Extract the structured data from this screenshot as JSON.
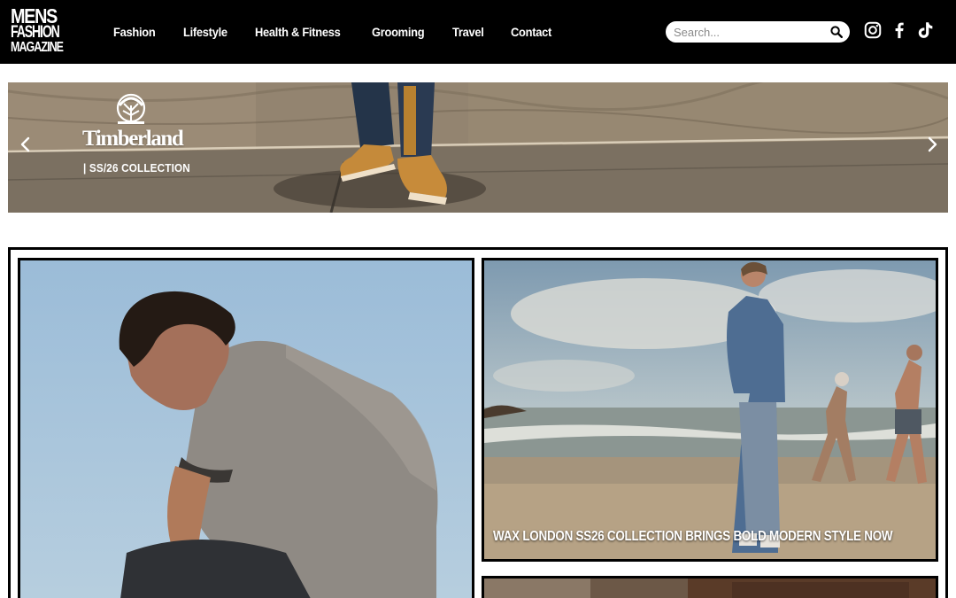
{
  "logo": {
    "line1": "MENS",
    "line2": "FASHION",
    "line3": "MAGAZINE"
  },
  "nav": {
    "items": [
      {
        "label": "Fashion"
      },
      {
        "label": "Lifestyle"
      },
      {
        "label": "Health & Fitness"
      },
      {
        "label": "Grooming"
      },
      {
        "label": "Travel"
      },
      {
        "label": "Contact"
      }
    ]
  },
  "search": {
    "placeholder": "Search...",
    "value": "",
    "icon": "search-icon"
  },
  "social": {
    "icons": [
      "instagram-icon",
      "facebook-icon",
      "tiktok-icon"
    ]
  },
  "banner": {
    "brand": "Timberland",
    "subtitle": "| SS/26 COLLECTION",
    "prev_icon": "chevron-left-icon",
    "next_icon": "chevron-right-icon"
  },
  "articles": [
    {
      "title": ""
    },
    {
      "title": "WAX LONDON SS26 COLLECTION BRINGS BOLD MODERN STYLE NOW"
    },
    {
      "title": ""
    }
  ],
  "colors": {
    "header_bg": "#000000",
    "text_light": "#ffffff",
    "border": "#000000"
  }
}
